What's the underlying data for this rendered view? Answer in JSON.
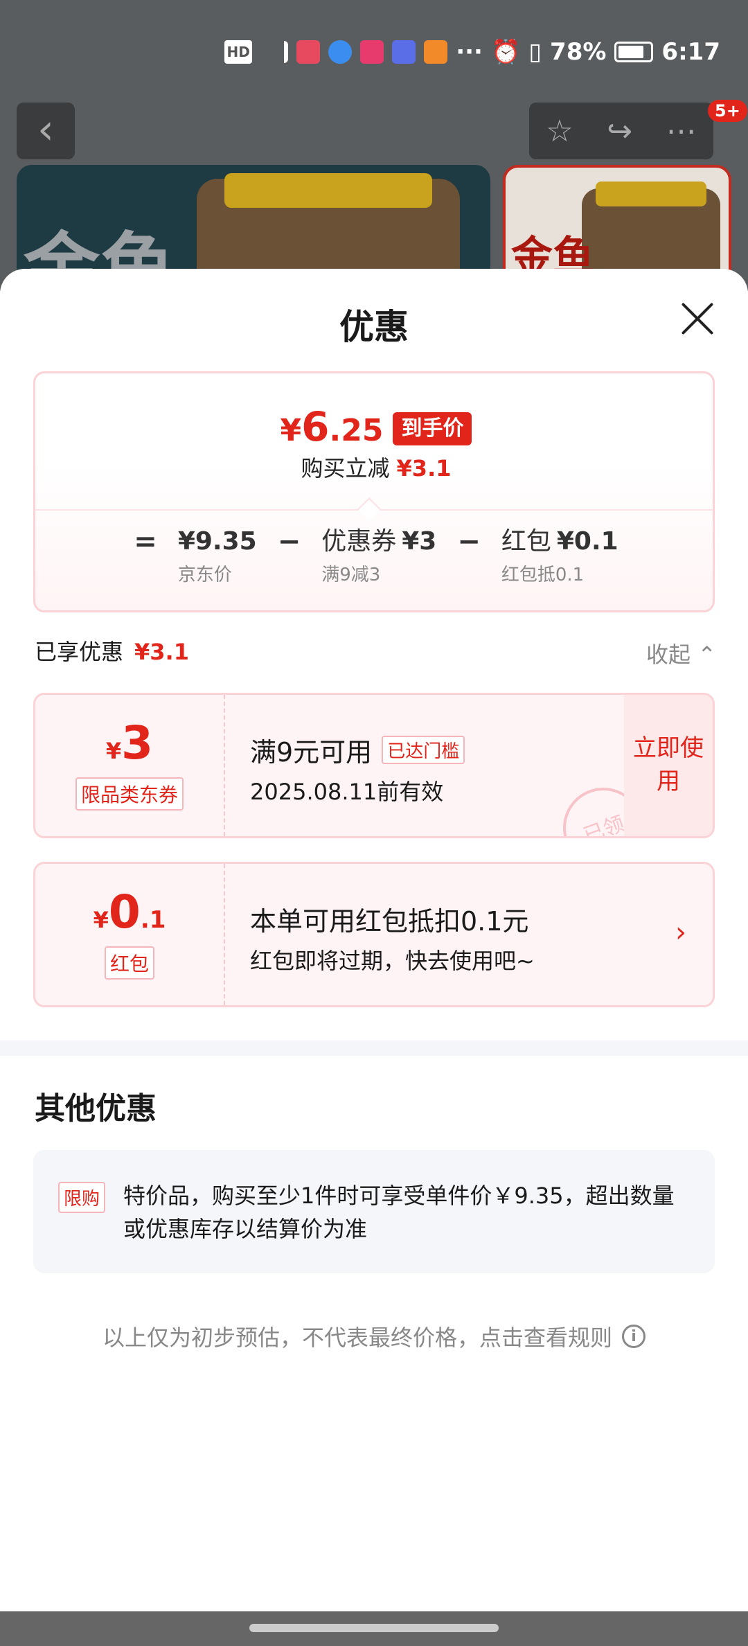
{
  "status_bar": {
    "battery": "78%",
    "time": "6:17",
    "hd_label": "HD"
  },
  "background_page": {
    "product1_text": "金鱼",
    "product2_text": "金鱼",
    "badge": "5+"
  },
  "sheet": {
    "title": "优惠"
  },
  "price_summary": {
    "yen": "¥",
    "final_int": "6",
    "final_dec": ".25",
    "final_tag": "到手价",
    "instant_label": "购买立减",
    "instant_value": "¥3.1",
    "formula": {
      "eq": "=",
      "minus": "−",
      "base_value": "¥9.35",
      "base_desc": "京东价",
      "coupon_label": "优惠券",
      "coupon_value": "¥3",
      "coupon_desc": "满9减3",
      "redpacket_label": "红包",
      "redpacket_value": "¥0.1",
      "redpacket_desc": "红包抵0.1"
    }
  },
  "enjoyed": {
    "label": "已享优惠",
    "value": "¥3.1",
    "collapse_label": "收起"
  },
  "coupons": [
    {
      "yen": "¥",
      "amount": "3",
      "amount_dec": "",
      "type": "限品类东券",
      "condition": "满9元可用",
      "threshold_badge": "已达门槛",
      "validity": "2025.08.11前有效",
      "action": "立即使用",
      "stamp": "已领"
    },
    {
      "yen": "¥",
      "amount": "0",
      "amount_dec": ".1",
      "type": "红包",
      "condition": "本单可用红包抵扣0.1元",
      "validity": "红包即将过期，快去使用吧~"
    }
  ],
  "other": {
    "title": "其他优惠",
    "tag": "限购",
    "text": "特价品，购买至少1件时可享受单件价￥9.35，超出数量或优惠库存以结算价为准"
  },
  "disclaimer": {
    "text": "以上仅为初步预估，不代表最终价格，点击查看规则"
  },
  "icons": {
    "back": "chevron-left-icon",
    "favorite": "star-icon",
    "share": "share-icon",
    "more": "more-icon",
    "close": "close-icon",
    "collapse": "chevron-up-icon",
    "arrow": "chevron-right-icon",
    "info": "info-icon"
  },
  "colors": {
    "accent": "#e1251b",
    "coupon_bg": "#fff4f5",
    "coupon_border": "#fbd2d6"
  }
}
